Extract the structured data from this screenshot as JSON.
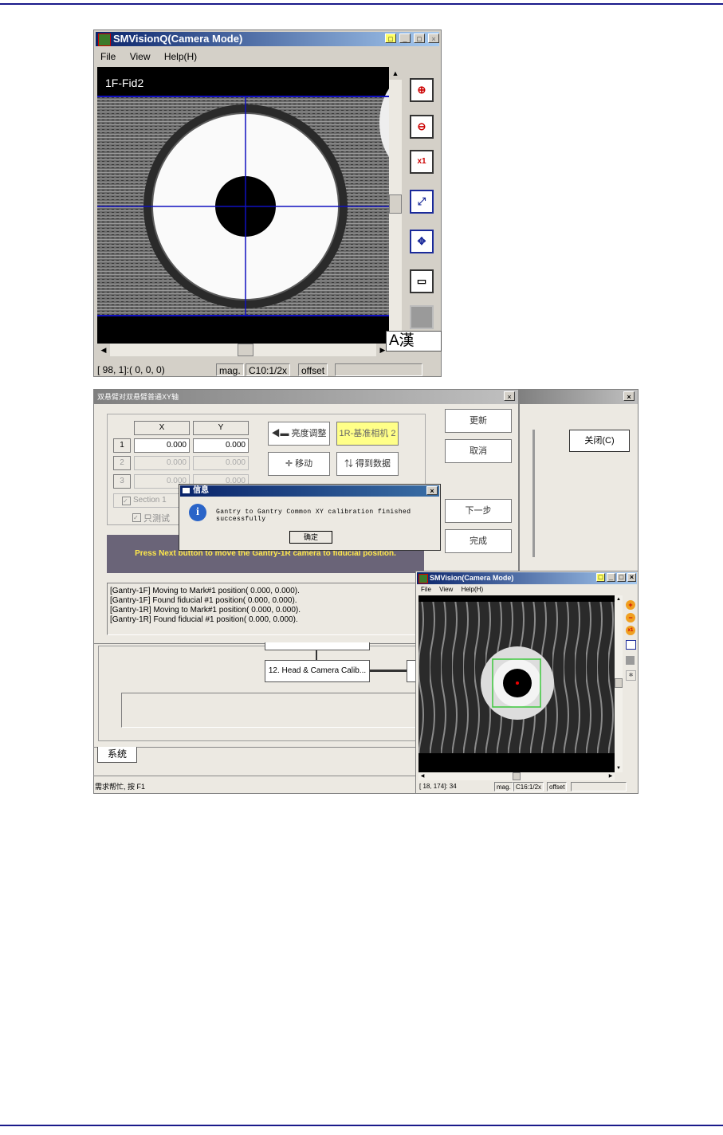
{
  "top_window": {
    "title": "SMVisionQ(Camera Mode)",
    "menu": [
      "File",
      "View",
      "Help(H)"
    ],
    "view_label": "1F-Fid2",
    "ime_text": "A漢",
    "status": {
      "coords": "[ 98,  1]:( 0, 0, 0)",
      "mag_label": "mag.",
      "mag_value": "C10:1/2x",
      "offset_label": "offset"
    },
    "tools": [
      "zoom-in-icon",
      "zoom-out-icon",
      "zoom-x1-icon",
      "fit-icon",
      "expand-icon",
      "window-icon",
      "gray-square-icon"
    ]
  },
  "calib_dialog": {
    "title": "双悬臂对双悬臂普通XY轴",
    "col_x": "X",
    "col_y": "Y",
    "rows": [
      {
        "n": "1",
        "x": "0.000",
        "y": "0.000"
      },
      {
        "n": "2",
        "x": "0.000",
        "y": "0.000"
      },
      {
        "n": "3",
        "x": "0.000",
        "y": "0.000"
      }
    ],
    "section_label": "Section 1",
    "test_label": "只测试",
    "btn_brightness": "亮度调整",
    "btn_camera": "1R-基准相机 2",
    "btn_move": "移动",
    "btn_getdata": "得到数据",
    "btn_update": "更新",
    "btn_cancel": "取消",
    "btn_next": "下一步",
    "btn_finish": "完成",
    "instruction": "Press Next button to move the Gantry-1R camera to fiducial position.",
    "log": [
      "[Gantry-1F] Moving to Mark#1 position( 0.000, 0.000).",
      "[Gantry-1F] Found fiducial #1 position( 0.000, 0.000).",
      "[Gantry-1R] Moving to Mark#1 position( 0.000, 0.000).",
      "[Gantry-1R] Found fiducial #1 position( 0.000, 0.000)."
    ]
  },
  "right_panel": {
    "close_button": "关闭(C)"
  },
  "info_box": {
    "title": "信息",
    "message": "Gantry to Gantry Common XY calibration finished successfully",
    "ok": "确定"
  },
  "flow": {
    "node": "12. Head & Camera Calib..."
  },
  "tab": {
    "label": "系统"
  },
  "bottom_status": "需求帮忙, 按 F1",
  "small_window": {
    "title": "SMVision(Camera Mode)",
    "menu": [
      "File",
      "View",
      "Help(H)"
    ],
    "status": {
      "coords": "[ 18, 174]: 34",
      "mag_label": "mag.",
      "mag_value": "C16:1/2x",
      "offset_label": "offset"
    }
  }
}
